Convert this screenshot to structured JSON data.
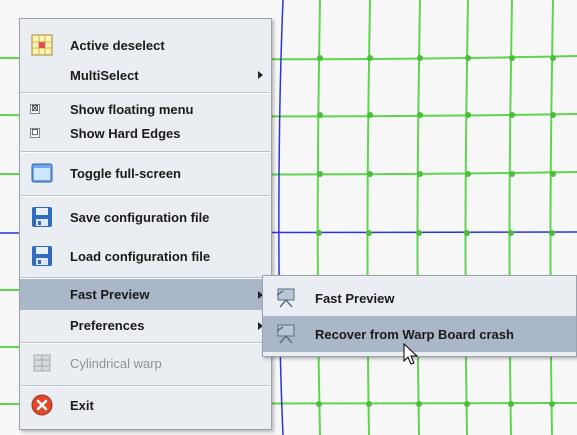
{
  "main_menu": {
    "items": [
      {
        "label": "Active deselect"
      },
      {
        "label": "MultiSelect"
      },
      {
        "label": "Show floating menu"
      },
      {
        "label": "Show Hard Edges"
      },
      {
        "label": "Toggle full-screen"
      },
      {
        "label": "Save configuration file"
      },
      {
        "label": "Load configuration file"
      },
      {
        "label": "Fast Preview"
      },
      {
        "label": "Preferences"
      },
      {
        "label": "Cylindrical warp"
      },
      {
        "label": "Exit"
      }
    ],
    "checks": {
      "show_floating_menu": "☒",
      "show_hard_edges": "☐"
    }
  },
  "sub_menu": {
    "items": [
      {
        "label": "Fast Preview"
      },
      {
        "label": "Recover from Warp Board crash"
      }
    ]
  },
  "colors": {
    "grid_line": "#5fd44f",
    "grid_node": "#4bbd3a",
    "guide_line": "#2a36d8",
    "menu_bg": "#eaeef2",
    "selection": "#a9b7c9"
  }
}
